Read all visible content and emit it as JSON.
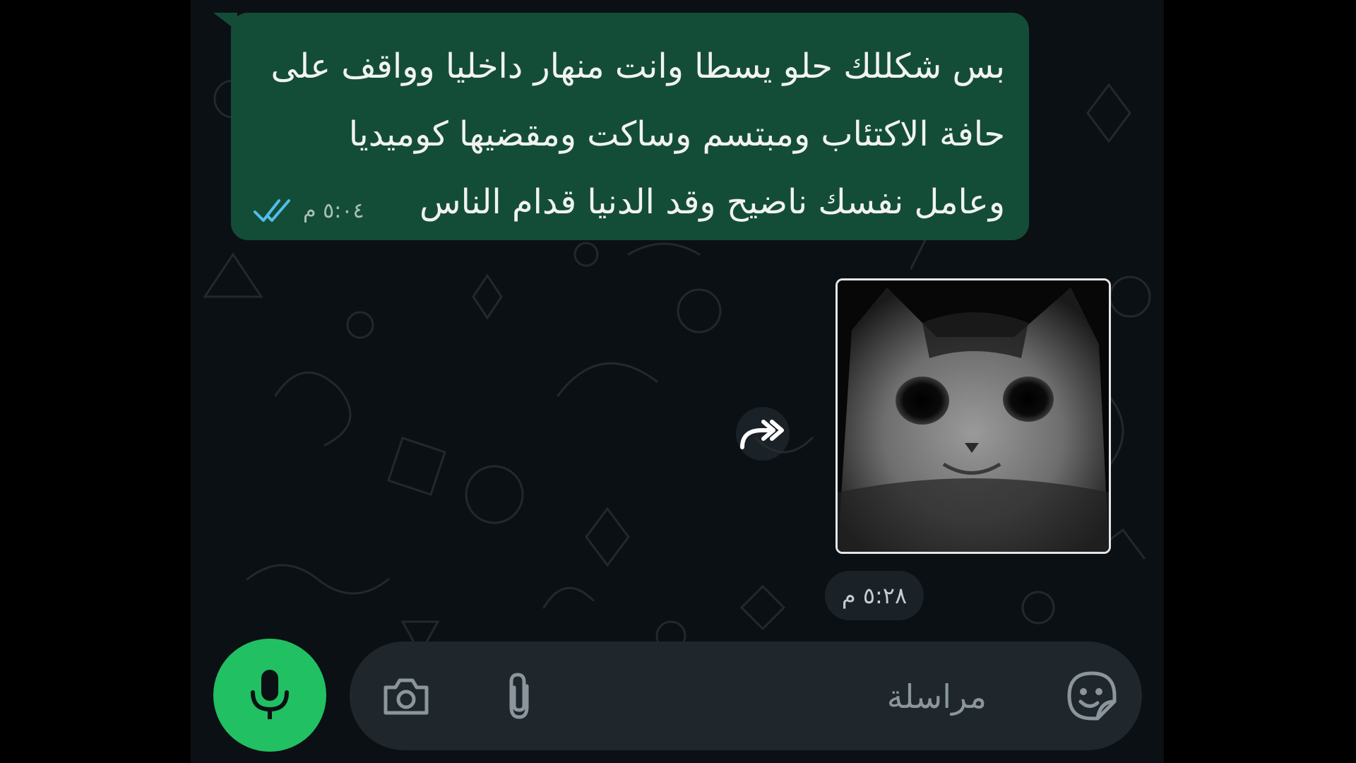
{
  "conversation": {
    "outgoing_message": {
      "lines": [
        "بس شكللك حلو يسطا وانت منهار داخليا وواقف على",
        "حافة الاكتئاب ومبتسم وساكت ومقضيها كوميديا",
        "وعامل نفسك ناضيح وقد الدنيا قدام الناس"
      ],
      "time": "٥:٠٤ م",
      "status_icon": "double-check-read-icon"
    },
    "incoming_sticker": {
      "time": "٥:٢٨ م",
      "sticker_icon": "cat-sticker",
      "forward_icon": "forward-icon"
    }
  },
  "composer": {
    "placeholder": "مراسلة",
    "icons": {
      "emoji": "sticker-emoji-icon",
      "attach": "paperclip-icon",
      "camera": "camera-icon",
      "voice": "microphone-icon"
    }
  },
  "colors": {
    "outgoing_bubble": "#144d37",
    "accent_green": "#21c063",
    "read_check": "#53bdeb",
    "background": "#0b1014"
  }
}
